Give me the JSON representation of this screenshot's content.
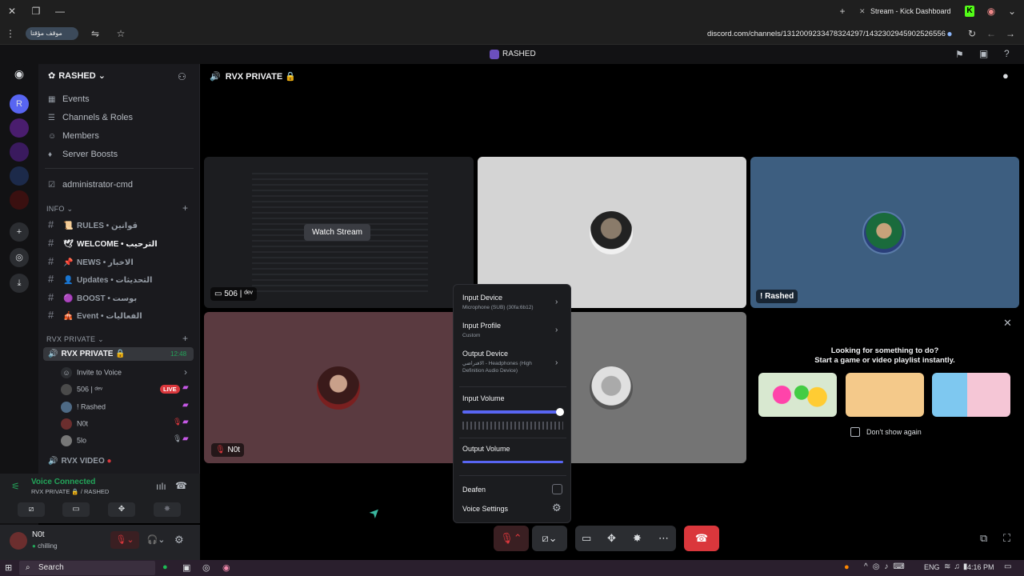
{
  "browser": {
    "tab_title": "Stream - Kick Dashboard",
    "security_label": "موقف مؤقتا",
    "url": "discord.com/channels/1312009233478324297/1432302945902526556"
  },
  "window": {
    "title": "RASHED"
  },
  "server": {
    "name": "RASHED",
    "menu": [
      "Events",
      "Channels & Roles",
      "Members",
      "Server Boosts"
    ],
    "pinned_channel": "administrator-cmd",
    "categories": {
      "info": "INFO",
      "rvx_private": "RVX PRIVATE"
    },
    "channels": [
      {
        "emoji": "📜",
        "name": "RULES • قوانين"
      },
      {
        "emoji": "🕊",
        "name": "WELCOME • الترحيب"
      },
      {
        "emoji": "📌",
        "name": "NEWS • الاخبار"
      },
      {
        "emoji": "👤",
        "name": "Updates • التحديثات"
      },
      {
        "emoji": "🟣",
        "name": "BOOST • بوست"
      },
      {
        "emoji": "🎪",
        "name": "Event • الفعاليات"
      }
    ],
    "voice_channel": {
      "name": "RVX PRIVATE 🔒",
      "timer": "12:48"
    },
    "invite_label": "Invite to Voice",
    "voice_users": [
      "506 | ᵈᵉᵛ",
      "! Rashed",
      "N0t",
      "5lo"
    ],
    "live_badge": "LIVE",
    "next_channel": "RVX VIDEO"
  },
  "voice_panel": {
    "status": "Voice Connected",
    "location": "RVX PRIVATE 🔒 / RASHED"
  },
  "user_panel": {
    "name": "N0t",
    "status": "chilling"
  },
  "main": {
    "channel_title": "RVX PRIVATE 🔒",
    "watch_stream": "Watch Stream",
    "tiles": {
      "stream_name": "506 | ᵈᵉᵛ",
      "rashed": "! Rashed",
      "not": "N0t"
    },
    "activity": {
      "line1": "Looking for something to do?",
      "line2": "Start a game or video playlist instantly.",
      "dont_show": "Don't show again"
    }
  },
  "audio_popup": {
    "input_device": "Input Device",
    "input_device_sub": "Microphone (SUB) (30fa:6b12)",
    "input_profile": "Input Profile",
    "input_profile_sub": "Custom",
    "output_device": "Output Device",
    "output_device_sub": "الافتراضي - Headphones (High Definition Audio Device)",
    "input_volume": "Input Volume",
    "input_volume_level": 1.0,
    "output_volume": "Output Volume",
    "output_volume_level": 1.0,
    "deafen": "Deafen",
    "voice_settings": "Voice Settings"
  },
  "taskbar": {
    "search": "Search",
    "lang": "ENG",
    "time": "4:16 PM"
  },
  "colors": {
    "accent": "#5865f2",
    "green": "#23a55a",
    "red": "#da373c",
    "live": "#da373c"
  }
}
